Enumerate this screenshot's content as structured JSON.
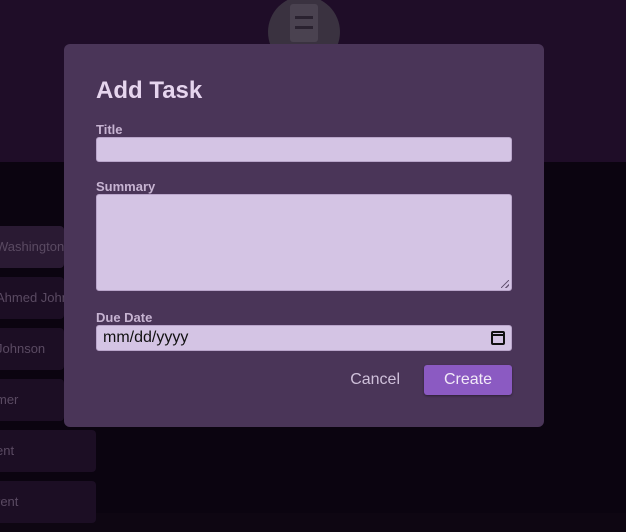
{
  "background": {
    "list_items": [
      "Washington",
      "Ahmed Johnson",
      "Johnson",
      "mer",
      "ent",
      "rent"
    ]
  },
  "dialog": {
    "title": "Add Task",
    "fields": {
      "title_label": "Title",
      "title_value": "",
      "summary_label": "Summary",
      "summary_value": "",
      "due_label": "Due Date",
      "due_value": "mm/dd/yyyy"
    },
    "buttons": {
      "cancel": "Cancel",
      "create": "Create"
    }
  },
  "colors": {
    "modal_bg": "#4a3558",
    "input_bg": "#d4c4e4",
    "accent": "#8b5ac2"
  }
}
